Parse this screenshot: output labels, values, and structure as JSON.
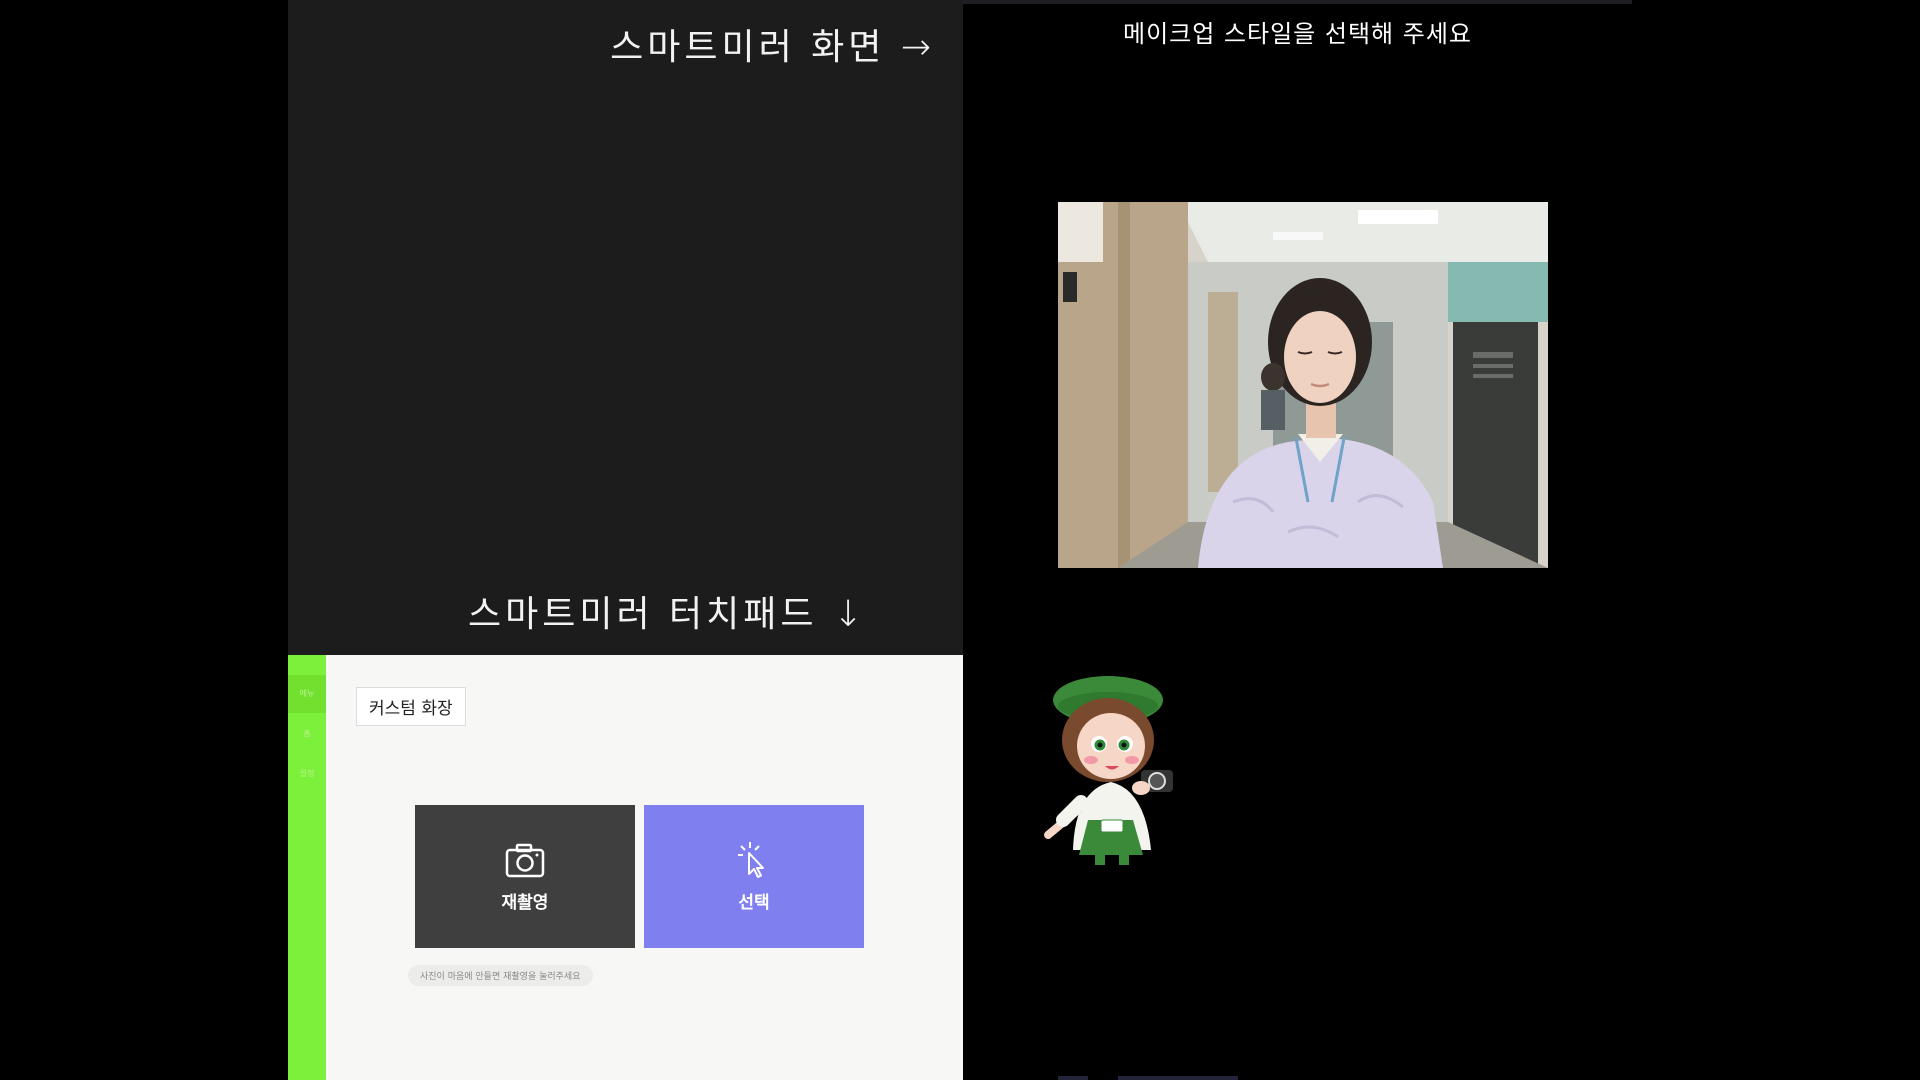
{
  "labels": {
    "mirror_screen": "스마트미러 화면 →",
    "touchpad": "스마트미러 터치패드 ↓"
  },
  "touchpad": {
    "rail_items": [
      "메뉴",
      "홈",
      "설정"
    ],
    "chip_label": "커스텀 화장",
    "buttons": {
      "retake": "재촬영",
      "select": "선택"
    },
    "hint": "사진이 마음에 안들면 재촬영을 눌러주세요"
  },
  "mirror": {
    "prompt": "메이크업 스타일을 선택해 주세요"
  },
  "colors": {
    "rail_green": "#7cf03a",
    "select_purple": "#7f7ff0",
    "retake_dark": "#3f3f3f"
  },
  "icons": {
    "retake": "camera-icon",
    "select": "tap-cursor-icon"
  }
}
